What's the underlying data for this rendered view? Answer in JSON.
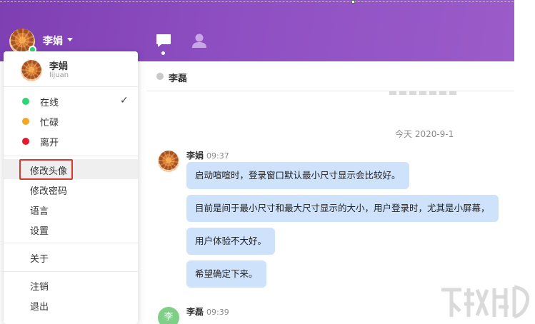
{
  "user": {
    "name": "李娟",
    "account": "lijuan",
    "status_color": "#2ed573"
  },
  "header": {
    "gradient": "#8e4fc2",
    "nav": [
      {
        "icon": "chat-bubble-icon",
        "active": true
      },
      {
        "icon": "contacts-person-icon",
        "active": false
      }
    ]
  },
  "dropdown": {
    "statuses": [
      {
        "label": "在线",
        "color": "#2ed573",
        "checked": true
      },
      {
        "label": "忙碌",
        "color": "#f5a623",
        "checked": false
      },
      {
        "label": "离开",
        "color": "#e8192c",
        "checked": false
      }
    ],
    "check_mark": "✓",
    "menu": [
      {
        "label": "修改头像",
        "highlighted": true
      },
      {
        "label": "修改密码"
      },
      {
        "label": "语言"
      },
      {
        "label": "设置"
      },
      {
        "label": "关于"
      },
      {
        "label": "注销"
      },
      {
        "label": "退出"
      }
    ]
  },
  "chat": {
    "peer_name": "李磊",
    "date_separator": "今天 2020-9-1",
    "messages": [
      {
        "sender": "李娟",
        "time": "09:37",
        "bubbles": [
          "启动喧喧时，登录窗口默认最小尺寸显示会比较好。",
          "目前是间于最小尺寸和最大尺寸显示的大小，用户登录时，尤其是小屏幕，",
          "用户体验不大好。",
          "希望确定下来。"
        ]
      },
      {
        "sender": "李磊",
        "time": "09:39",
        "avatar_text": "李"
      }
    ]
  }
}
